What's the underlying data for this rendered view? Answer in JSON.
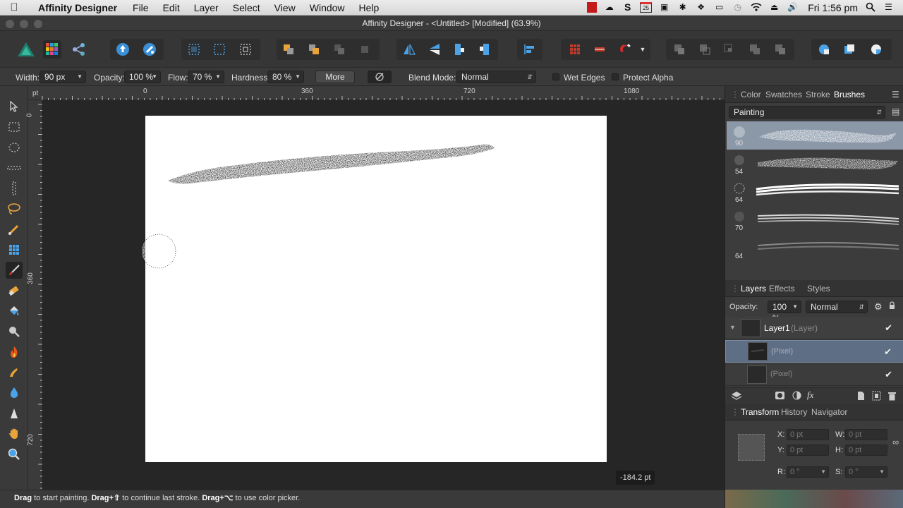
{
  "menubar": {
    "app_name": "Affinity Designer",
    "items": [
      "File",
      "Edit",
      "Layer",
      "Select",
      "View",
      "Window",
      "Help"
    ],
    "status_icons": [
      "red-app-icon",
      "cloud-icon",
      "s-icon",
      "calendar-icon",
      "display-icon",
      "bluetooth-icon",
      "dropbox-icon",
      "airplay-icon",
      "time-machine-icon",
      "wifi-icon",
      "eject-icon",
      "volume-icon"
    ],
    "calendar_day": "25",
    "clock": "Fri 1:56 pm"
  },
  "window": {
    "title": "Affinity Designer - <Untitled> [Modified] (63.9%)"
  },
  "context_toolbar": {
    "width_label": "Width:",
    "width_value": "90 px",
    "opacity_label": "Opacity:",
    "opacity_value": "100 %",
    "flow_label": "Flow:",
    "flow_value": "70 %",
    "hardness_label": "Hardness:",
    "hardness_value": "80 %",
    "more_label": "More",
    "blend_label": "Blend Mode:",
    "blend_value": "Normal",
    "wet_edges_label": "Wet Edges",
    "protect_alpha_label": "Protect Alpha"
  },
  "rulers": {
    "unit": "pt",
    "h_ticks": [
      "0",
      "360",
      "720",
      "1080"
    ],
    "v_ticks": [
      "0",
      "360",
      "720"
    ]
  },
  "canvas": {
    "coord_readout": "-184.2 pt"
  },
  "status_bar": {
    "drag": "Drag",
    "t1": " to start painting. ",
    "drag2": "Drag+⇧",
    "t2": " to continue last stroke. ",
    "drag3": "Drag+⌥",
    "t3": " to use color picker."
  },
  "brushes_panel": {
    "tabs": [
      "Color",
      "Swatches",
      "Stroke",
      "Brushes"
    ],
    "active_tab": "Brushes",
    "category": "Painting",
    "brushes": [
      {
        "size": "90"
      },
      {
        "size": "54"
      },
      {
        "size": "64"
      },
      {
        "size": "70"
      },
      {
        "size": "64"
      }
    ]
  },
  "layers_panel": {
    "tabs": [
      "Layers",
      "Effects",
      "Styles"
    ],
    "opacity_label": "Opacity:",
    "opacity_value": "100 %",
    "blend_value": "Normal",
    "layer_name": "Layer1",
    "layer_type": "(Layer)",
    "children": [
      {
        "name": "(Pixel)"
      },
      {
        "name": "(Pixel)"
      }
    ]
  },
  "transform_panel": {
    "tabs": [
      "Transform",
      "History",
      "Navigator"
    ],
    "x_label": "X:",
    "x_value": "0 pt",
    "y_label": "Y:",
    "y_value": "0 pt",
    "w_label": "W:",
    "w_value": "0 pt",
    "h_label": "H:",
    "h_value": "0 pt",
    "r_label": "R:",
    "r_value": "0 °",
    "s_label": "S:",
    "s_value": "0 °"
  },
  "colors": {
    "accent": "#3a8fd6",
    "selected_row": "#5e6f85"
  }
}
